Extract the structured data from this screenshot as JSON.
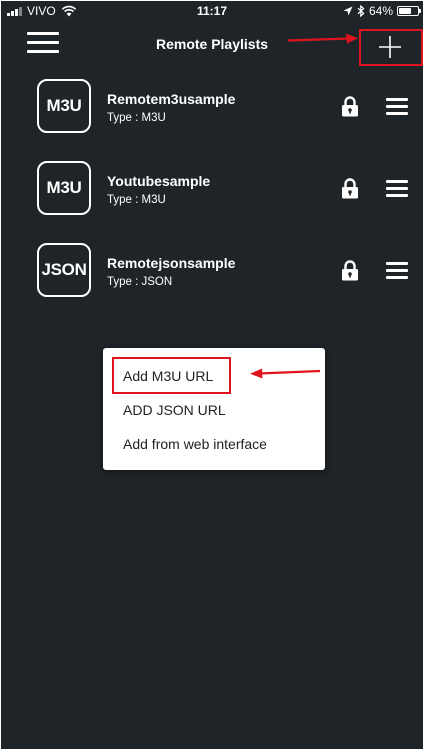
{
  "status_bar": {
    "carrier": "VIVO",
    "time": "11:17",
    "battery_percent": "64%",
    "battery_level": 0.64
  },
  "header": {
    "title": "Remote Playlists",
    "menu_icon": "hamburger-icon",
    "add_icon": "plus-icon"
  },
  "playlists": [
    {
      "badge": "M3U",
      "name": "Remotem3usample",
      "type": "Type : M3U"
    },
    {
      "badge": "M3U",
      "name": "Youtubesample",
      "type": "Type : M3U"
    },
    {
      "badge": "JSON",
      "name": "Remotejsonsample",
      "type": "Type : JSON"
    }
  ],
  "popup_menu": {
    "items": [
      {
        "label": "Add M3U URL"
      },
      {
        "label": "ADD JSON URL"
      },
      {
        "label": "Add from web interface"
      }
    ]
  },
  "colors": {
    "background": "#1f2428",
    "text": "#ffffff",
    "menu_background": "#ffffff",
    "menu_text": "#222222",
    "annotation_red": "#e0141e"
  },
  "icons": {
    "row_lock": "lock-icon",
    "row_menu": "hamburger-icon"
  }
}
